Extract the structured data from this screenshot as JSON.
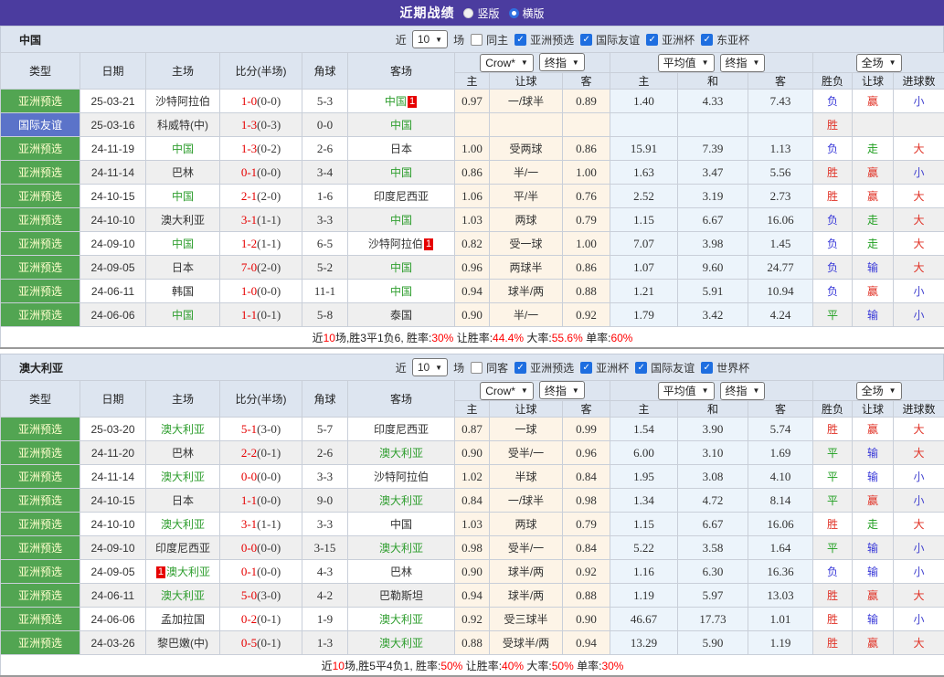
{
  "topbar": {
    "title": "近期战绩",
    "vertical": "竖版",
    "horizontal": "横版"
  },
  "labels": {
    "near": "近",
    "games": "10",
    "games_unit": "场",
    "col_type": "类型",
    "col_date": "日期",
    "col_home": "主场",
    "col_score": "比分(半场)",
    "col_corner": "角球",
    "col_away": "客场",
    "sel_crow": "Crow*",
    "sel_final": "终指",
    "sel_avg": "平均值",
    "sel_full": "全场",
    "col_home_odds": "主",
    "col_handicap": "让球",
    "col_away_odds": "客",
    "col_avg_home": "主",
    "col_draw": "和",
    "col_avg_away": "客",
    "col_result": "胜负",
    "col_handicap_result": "让球",
    "col_goals": "进球数"
  },
  "sections": [
    {
      "team": "中国",
      "same_label": "同主",
      "same_checked": false,
      "competitions": [
        "亚洲预选",
        "国际友谊",
        "亚洲杯",
        "东亚杯"
      ],
      "rows": [
        {
          "comp": "亚洲预选",
          "comp_color": "green",
          "date": "25-03-21",
          "home": "沙特阿拉伯",
          "home_green": false,
          "home_badge": "",
          "score": "1-0",
          "half": "(0-0)",
          "corner": "5-3",
          "away": "中国",
          "away_green": true,
          "away_badge": "1",
          "crow": [
            "0.97",
            "一/球半",
            "0.89"
          ],
          "avg": [
            "1.40",
            "4.33",
            "7.43"
          ],
          "result": "负",
          "let_result": "赢",
          "goal_result": "小"
        },
        {
          "comp": "国际友谊",
          "comp_color": "blue",
          "date": "25-03-16",
          "home": "科威特(中)",
          "home_green": false,
          "home_badge": "",
          "score": "1-3",
          "half": "(0-3)",
          "corner": "0-0",
          "away": "中国",
          "away_green": true,
          "away_badge": "",
          "crow": [
            "",
            "",
            ""
          ],
          "avg": [
            "",
            "",
            ""
          ],
          "result": "胜",
          "let_result": "",
          "goal_result": ""
        },
        {
          "comp": "亚洲预选",
          "comp_color": "green",
          "date": "24-11-19",
          "home": "中国",
          "home_green": true,
          "home_badge": "",
          "score": "1-3",
          "half": "(0-2)",
          "corner": "2-6",
          "away": "日本",
          "away_green": false,
          "away_badge": "",
          "crow": [
            "1.00",
            "受两球",
            "0.86"
          ],
          "avg": [
            "15.91",
            "7.39",
            "1.13"
          ],
          "result": "负",
          "let_result": "走",
          "goal_result": "大"
        },
        {
          "comp": "亚洲预选",
          "comp_color": "green",
          "date": "24-11-14",
          "home": "巴林",
          "home_green": false,
          "home_badge": "",
          "score": "0-1",
          "half": "(0-0)",
          "corner": "3-4",
          "away": "中国",
          "away_green": true,
          "away_badge": "",
          "crow": [
            "0.86",
            "半/一",
            "1.00"
          ],
          "avg": [
            "1.63",
            "3.47",
            "5.56"
          ],
          "result": "胜",
          "let_result": "赢",
          "goal_result": "小"
        },
        {
          "comp": "亚洲预选",
          "comp_color": "green",
          "date": "24-10-15",
          "home": "中国",
          "home_green": true,
          "home_badge": "",
          "score": "2-1",
          "half": "(2-0)",
          "corner": "1-6",
          "away": "印度尼西亚",
          "away_green": false,
          "away_badge": "",
          "crow": [
            "1.06",
            "平/半",
            "0.76"
          ],
          "avg": [
            "2.52",
            "3.19",
            "2.73"
          ],
          "result": "胜",
          "let_result": "赢",
          "goal_result": "大"
        },
        {
          "comp": "亚洲预选",
          "comp_color": "green",
          "date": "24-10-10",
          "home": "澳大利亚",
          "home_green": false,
          "home_badge": "",
          "score": "3-1",
          "half": "(1-1)",
          "corner": "3-3",
          "away": "中国",
          "away_green": true,
          "away_badge": "",
          "crow": [
            "1.03",
            "两球",
            "0.79"
          ],
          "avg": [
            "1.15",
            "6.67",
            "16.06"
          ],
          "result": "负",
          "let_result": "走",
          "goal_result": "大"
        },
        {
          "comp": "亚洲预选",
          "comp_color": "green",
          "date": "24-09-10",
          "home": "中国",
          "home_green": true,
          "home_badge": "",
          "score": "1-2",
          "half": "(1-1)",
          "corner": "6-5",
          "away": "沙特阿拉伯",
          "away_green": false,
          "away_badge": "1",
          "crow": [
            "0.82",
            "受一球",
            "1.00"
          ],
          "avg": [
            "7.07",
            "3.98",
            "1.45"
          ],
          "result": "负",
          "let_result": "走",
          "goal_result": "大"
        },
        {
          "comp": "亚洲预选",
          "comp_color": "green",
          "date": "24-09-05",
          "home": "日本",
          "home_green": false,
          "home_badge": "",
          "score": "7-0",
          "half": "(2-0)",
          "corner": "5-2",
          "away": "中国",
          "away_green": true,
          "away_badge": "",
          "crow": [
            "0.96",
            "两球半",
            "0.86"
          ],
          "avg": [
            "1.07",
            "9.60",
            "24.77"
          ],
          "result": "负",
          "let_result": "输",
          "goal_result": "大"
        },
        {
          "comp": "亚洲预选",
          "comp_color": "green",
          "date": "24-06-11",
          "home": "韩国",
          "home_green": false,
          "home_badge": "",
          "score": "1-0",
          "half": "(0-0)",
          "corner": "11-1",
          "away": "中国",
          "away_green": true,
          "away_badge": "",
          "crow": [
            "0.94",
            "球半/两",
            "0.88"
          ],
          "avg": [
            "1.21",
            "5.91",
            "10.94"
          ],
          "result": "负",
          "let_result": "赢",
          "goal_result": "小"
        },
        {
          "comp": "亚洲预选",
          "comp_color": "green",
          "date": "24-06-06",
          "home": "中国",
          "home_green": true,
          "home_badge": "",
          "score": "1-1",
          "half": "(0-1)",
          "corner": "5-8",
          "away": "泰国",
          "away_green": false,
          "away_badge": "",
          "crow": [
            "0.90",
            "半/一",
            "0.92"
          ],
          "avg": [
            "1.79",
            "3.42",
            "4.24"
          ],
          "result": "平",
          "let_result": "输",
          "goal_result": "小"
        }
      ],
      "summary": [
        {
          "t": "近",
          "r": false
        },
        {
          "t": "10",
          "r": true
        },
        {
          "t": "场,胜3平1负6, 胜率:",
          "r": false
        },
        {
          "t": "30%",
          "r": true
        },
        {
          "t": " 让胜率:",
          "r": false
        },
        {
          "t": "44.4%",
          "r": true
        },
        {
          "t": " 大率:",
          "r": false
        },
        {
          "t": "55.6%",
          "r": true
        },
        {
          "t": " 单率:",
          "r": false
        },
        {
          "t": "60%",
          "r": true
        }
      ]
    },
    {
      "team": "澳大利亚",
      "same_label": "同客",
      "same_checked": false,
      "competitions": [
        "亚洲预选",
        "亚洲杯",
        "国际友谊",
        "世界杯"
      ],
      "rows": [
        {
          "comp": "亚洲预选",
          "comp_color": "green",
          "date": "25-03-20",
          "home": "澳大利亚",
          "home_green": true,
          "home_badge": "",
          "score": "5-1",
          "half": "(3-0)",
          "corner": "5-7",
          "away": "印度尼西亚",
          "away_green": false,
          "away_badge": "",
          "crow": [
            "0.87",
            "一球",
            "0.99"
          ],
          "avg": [
            "1.54",
            "3.90",
            "5.74"
          ],
          "result": "胜",
          "let_result": "赢",
          "goal_result": "大"
        },
        {
          "comp": "亚洲预选",
          "comp_color": "green",
          "date": "24-11-20",
          "home": "巴林",
          "home_green": false,
          "home_badge": "",
          "score": "2-2",
          "half": "(0-1)",
          "corner": "2-6",
          "away": "澳大利亚",
          "away_green": true,
          "away_badge": "",
          "crow": [
            "0.90",
            "受半/一",
            "0.96"
          ],
          "avg": [
            "6.00",
            "3.10",
            "1.69"
          ],
          "result": "平",
          "let_result": "输",
          "goal_result": "大"
        },
        {
          "comp": "亚洲预选",
          "comp_color": "green",
          "date": "24-11-14",
          "home": "澳大利亚",
          "home_green": true,
          "home_badge": "",
          "score": "0-0",
          "half": "(0-0)",
          "corner": "3-3",
          "away": "沙特阿拉伯",
          "away_green": false,
          "away_badge": "",
          "crow": [
            "1.02",
            "半球",
            "0.84"
          ],
          "avg": [
            "1.95",
            "3.08",
            "4.10"
          ],
          "result": "平",
          "let_result": "输",
          "goal_result": "小"
        },
        {
          "comp": "亚洲预选",
          "comp_color": "green",
          "date": "24-10-15",
          "home": "日本",
          "home_green": false,
          "home_badge": "",
          "score": "1-1",
          "half": "(0-0)",
          "corner": "9-0",
          "away": "澳大利亚",
          "away_green": true,
          "away_badge": "",
          "crow": [
            "0.84",
            "一/球半",
            "0.98"
          ],
          "avg": [
            "1.34",
            "4.72",
            "8.14"
          ],
          "result": "平",
          "let_result": "赢",
          "goal_result": "小"
        },
        {
          "comp": "亚洲预选",
          "comp_color": "green",
          "date": "24-10-10",
          "home": "澳大利亚",
          "home_green": true,
          "home_badge": "",
          "score": "3-1",
          "half": "(1-1)",
          "corner": "3-3",
          "away": "中国",
          "away_green": false,
          "away_badge": "",
          "crow": [
            "1.03",
            "两球",
            "0.79"
          ],
          "avg": [
            "1.15",
            "6.67",
            "16.06"
          ],
          "result": "胜",
          "let_result": "走",
          "goal_result": "大"
        },
        {
          "comp": "亚洲预选",
          "comp_color": "green",
          "date": "24-09-10",
          "home": "印度尼西亚",
          "home_green": false,
          "home_badge": "",
          "score": "0-0",
          "half": "(0-0)",
          "corner": "3-15",
          "away": "澳大利亚",
          "away_green": true,
          "away_badge": "",
          "crow": [
            "0.98",
            "受半/一",
            "0.84"
          ],
          "avg": [
            "5.22",
            "3.58",
            "1.64"
          ],
          "result": "平",
          "let_result": "输",
          "goal_result": "小"
        },
        {
          "comp": "亚洲预选",
          "comp_color": "green",
          "date": "24-09-05",
          "home": "澳大利亚",
          "home_green": true,
          "home_badge": "1",
          "score": "0-1",
          "half": "(0-0)",
          "corner": "4-3",
          "away": "巴林",
          "away_green": false,
          "away_badge": "",
          "crow": [
            "0.90",
            "球半/两",
            "0.92"
          ],
          "avg": [
            "1.16",
            "6.30",
            "16.36"
          ],
          "result": "负",
          "let_result": "输",
          "goal_result": "小"
        },
        {
          "comp": "亚洲预选",
          "comp_color": "green",
          "date": "24-06-11",
          "home": "澳大利亚",
          "home_green": true,
          "home_badge": "",
          "score": "5-0",
          "half": "(3-0)",
          "corner": "4-2",
          "away": "巴勒斯坦",
          "away_green": false,
          "away_badge": "",
          "crow": [
            "0.94",
            "球半/两",
            "0.88"
          ],
          "avg": [
            "1.19",
            "5.97",
            "13.03"
          ],
          "result": "胜",
          "let_result": "赢",
          "goal_result": "大"
        },
        {
          "comp": "亚洲预选",
          "comp_color": "green",
          "date": "24-06-06",
          "home": "孟加拉国",
          "home_green": false,
          "home_badge": "",
          "score": "0-2",
          "half": "(0-1)",
          "corner": "1-9",
          "away": "澳大利亚",
          "away_green": true,
          "away_badge": "",
          "crow": [
            "0.92",
            "受三球半",
            "0.90"
          ],
          "avg": [
            "46.67",
            "17.73",
            "1.01"
          ],
          "result": "胜",
          "let_result": "输",
          "goal_result": "小"
        },
        {
          "comp": "亚洲预选",
          "comp_color": "green",
          "date": "24-03-26",
          "home": "黎巴嫩(中)",
          "home_green": false,
          "home_badge": "",
          "score": "0-5",
          "half": "(0-1)",
          "corner": "1-3",
          "away": "澳大利亚",
          "away_green": true,
          "away_badge": "",
          "crow": [
            "0.88",
            "受球半/两",
            "0.94"
          ],
          "avg": [
            "13.29",
            "5.90",
            "1.19"
          ],
          "result": "胜",
          "let_result": "赢",
          "goal_result": "大"
        }
      ],
      "summary": [
        {
          "t": "近",
          "r": false
        },
        {
          "t": "10",
          "r": true
        },
        {
          "t": "场,胜5平4负1, 胜率:",
          "r": false
        },
        {
          "t": "50%",
          "r": true
        },
        {
          "t": " 让胜率:",
          "r": false
        },
        {
          "t": "40%",
          "r": true
        },
        {
          "t": " 大率:",
          "r": false
        },
        {
          "t": "50%",
          "r": true
        },
        {
          "t": " 单率:",
          "r": false
        },
        {
          "t": "30%",
          "r": true
        }
      ]
    }
  ]
}
